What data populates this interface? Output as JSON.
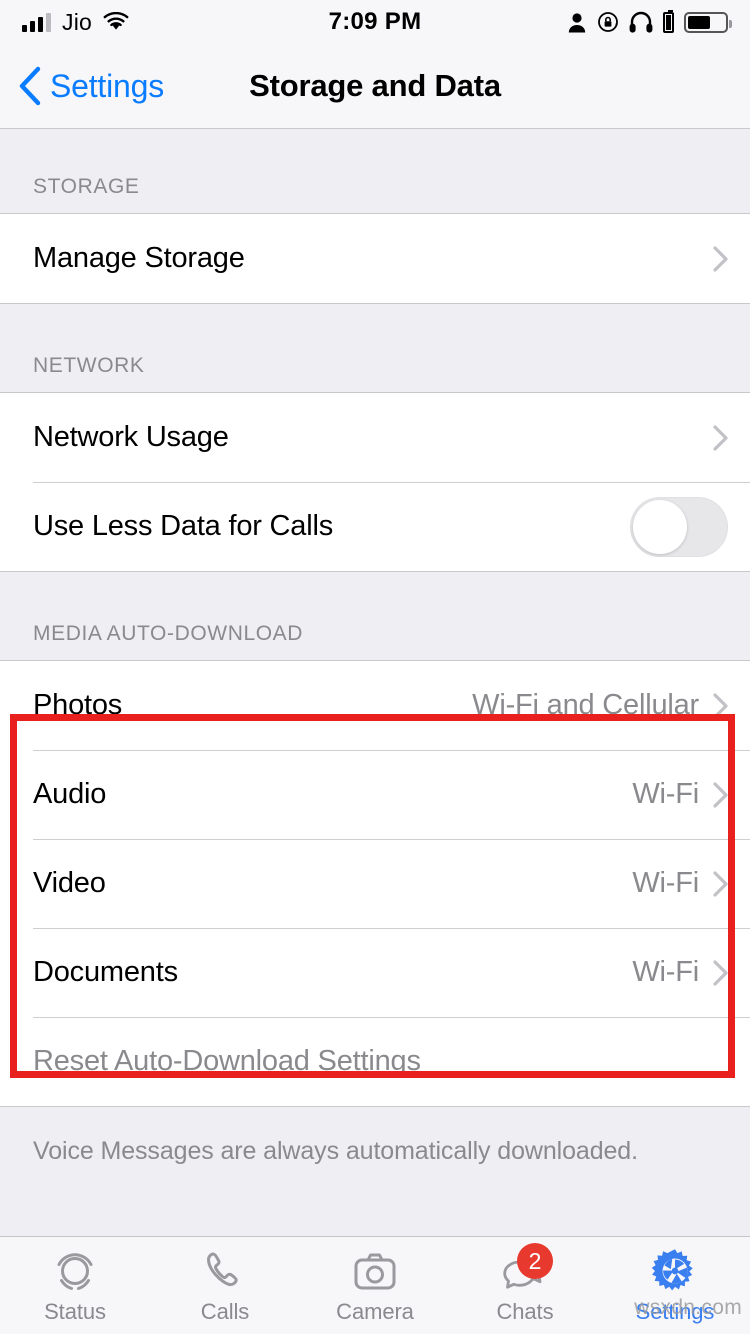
{
  "status_bar": {
    "carrier": "Jio",
    "time": "7:09 PM",
    "icons": [
      "signal-bars-icon",
      "wifi-icon",
      "person-icon",
      "rotation-lock-icon",
      "headphones-icon",
      "accessory-battery-icon",
      "battery-icon"
    ]
  },
  "nav": {
    "back_label": "Settings",
    "title": "Storage and Data"
  },
  "sections": [
    {
      "header": "STORAGE",
      "rows": [
        {
          "label": "Manage Storage",
          "value": "",
          "accessory": "chevron"
        }
      ]
    },
    {
      "header": "NETWORK",
      "rows": [
        {
          "label": "Network Usage",
          "value": "",
          "accessory": "chevron"
        },
        {
          "label": "Use Less Data for Calls",
          "value": "",
          "accessory": "switch",
          "switch_on": false
        }
      ]
    },
    {
      "header": "MEDIA AUTO-DOWNLOAD",
      "rows": [
        {
          "label": "Photos",
          "value": "Wi-Fi and Cellular",
          "accessory": "chevron"
        },
        {
          "label": "Audio",
          "value": "Wi-Fi",
          "accessory": "chevron"
        },
        {
          "label": "Video",
          "value": "Wi-Fi",
          "accessory": "chevron"
        },
        {
          "label": "Documents",
          "value": "Wi-Fi",
          "accessory": "chevron"
        },
        {
          "label": "Reset Auto-Download Settings",
          "value": "",
          "accessory": "none"
        }
      ]
    }
  ],
  "footer_note": "Voice Messages are always automatically downloaded.",
  "highlight": {
    "color": "#e8211f",
    "covers": [
      "Photos",
      "Audio",
      "Video",
      "Documents"
    ]
  },
  "tab_bar": {
    "items": [
      {
        "label": "Status",
        "icon": "status-rings-icon",
        "active": false,
        "badge": ""
      },
      {
        "label": "Calls",
        "icon": "phone-icon",
        "active": false,
        "badge": ""
      },
      {
        "label": "Camera",
        "icon": "camera-icon",
        "active": false,
        "badge": ""
      },
      {
        "label": "Chats",
        "icon": "chat-bubbles-icon",
        "active": false,
        "badge": "2"
      },
      {
        "label": "Settings",
        "icon": "gear-icon",
        "active": true,
        "badge": ""
      }
    ]
  },
  "watermark": "wsxdn.com",
  "colors": {
    "accent_blue": "#0a7cff",
    "tab_active_blue": "#3a7ff0",
    "highlight_red": "#e8211f",
    "badge_red": "#e8392e",
    "secondary_text": "#8a8a8e",
    "group_bg": "#ffffff",
    "page_bg": "#efeef3"
  }
}
